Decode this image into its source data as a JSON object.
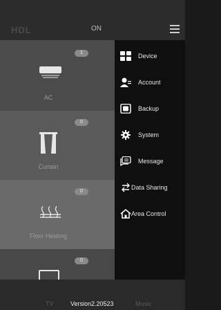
{
  "header": {
    "logo": "HDL",
    "status": "ON"
  },
  "rooms": [
    {
      "label": "AC",
      "count": "1"
    },
    {
      "label": "Curtain",
      "count": "0"
    },
    {
      "label": "Floor Heating",
      "count": "0"
    },
    {
      "label": "TV",
      "count": "0"
    }
  ],
  "bottom": {
    "music": "Music"
  },
  "menu": [
    {
      "label": "Device",
      "icon": "grid-icon"
    },
    {
      "label": "Account",
      "icon": "account-icon"
    },
    {
      "label": "Backup",
      "icon": "backup-icon"
    },
    {
      "label": "System",
      "icon": "gear-icon"
    },
    {
      "label": "Message",
      "icon": "message-icon"
    },
    {
      "label": "Data Sharing",
      "icon": "share-icon"
    },
    {
      "label": "Area Control",
      "icon": "home-icon"
    }
  ],
  "footer": {
    "version": "Version2.20523"
  }
}
